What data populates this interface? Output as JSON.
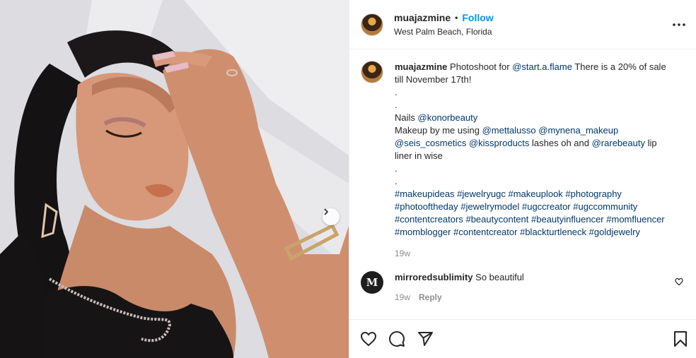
{
  "post": {
    "username": "muajazmine",
    "follow_label": "Follow",
    "location": "West Palm Beach, Florida",
    "image_alt": "Photo of a woman with dark hair and closed eyes resting her hand on her forehead, wearing a gold chain necklace and bracelet"
  },
  "caption": {
    "username": "muajazmine",
    "line1_pre": "Photoshoot for ",
    "line1_mention": "@start.a.flame",
    "line1_post": " There is a 20% of sale till November 17th!",
    "dot1": ".",
    "dot2": ".",
    "nails_pre": "Nails ",
    "nails_mention": "@konorbeauty",
    "makeup_pre": "Makeup by me using ",
    "makeup_m1": "@mettalusso",
    "makeup_m2": "@mynena_makeup",
    "makeup_m3": "@seis_cosmetics",
    "makeup_m4": "@kissproducts",
    "makeup_mid": " lashes oh and ",
    "makeup_m5": "@rarebeauty",
    "makeup_post": " lip liner in wise",
    "dot3": ".",
    "dot4": ".",
    "hashtags": [
      "#makeupideas",
      "#jewelryugc",
      "#makeuplook",
      "#photography",
      "#photooftheday",
      "#jewelrymodel",
      "#ugccreator",
      "#ugccommunity",
      "#contentcreators",
      "#beautycontent",
      "#beautyinfluencer",
      "#momfluencer",
      "#momblogger",
      "#contentcreator",
      "#blackturtleneck",
      "#goldjewelry"
    ],
    "time": "19w"
  },
  "comment": {
    "avatar_initials": "M",
    "username": "mirroredsublimity",
    "text": "So beautiful",
    "time": "19w",
    "reply_label": "Reply"
  },
  "icons": {
    "more": "more-icon",
    "like": "heart-icon",
    "comment": "comment-icon",
    "share": "share-icon",
    "save": "bookmark-icon",
    "carousel": "chevron-right-icon"
  }
}
